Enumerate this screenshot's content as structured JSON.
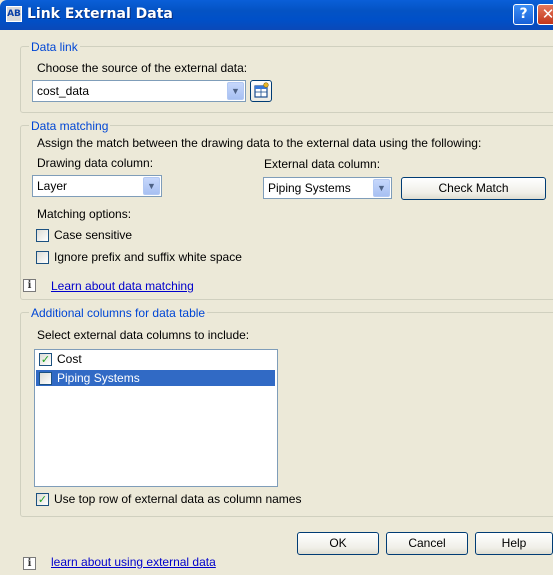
{
  "window": {
    "title": "Link External Data",
    "help_glyph": "?",
    "close_glyph": "✕",
    "app_icon_text": "AB"
  },
  "data_link": {
    "group_title": "Data link",
    "prompt": "Choose the source of the external data:",
    "source_value": "cost_data"
  },
  "data_matching": {
    "group_title": "Data matching",
    "description": "Assign the match between the drawing data to the external data using the following:",
    "drawing_column_label": "Drawing data column:",
    "drawing_column_value": "Layer",
    "external_column_label": "External data column:",
    "external_column_value": "Piping Systems",
    "check_match_label": "Check Match",
    "matching_options_label": "Matching options:",
    "case_sensitive_label": "Case sensitive",
    "case_sensitive_checked": false,
    "ignore_whitespace_label": "Ignore prefix and suffix white space",
    "ignore_whitespace_checked": false,
    "learn_link": "Learn about data matching"
  },
  "additional_columns": {
    "group_title": "Additional columns for data table",
    "prompt": "Select external data columns to include:",
    "items": [
      {
        "label": "Cost",
        "checked": true,
        "selected": false
      },
      {
        "label": "Piping Systems",
        "checked": false,
        "selected": true
      }
    ],
    "use_top_row_label": "Use top row of external data as column names",
    "use_top_row_checked": true
  },
  "footer": {
    "ok_label": "OK",
    "cancel_label": "Cancel",
    "help_label": "Help",
    "learn_link": "learn about using external data"
  },
  "colors": {
    "title_bar": "#0453c4",
    "group_title": "#0046d5",
    "link": "#0000cc",
    "selection": "#316ac5",
    "check": "#21a121"
  }
}
